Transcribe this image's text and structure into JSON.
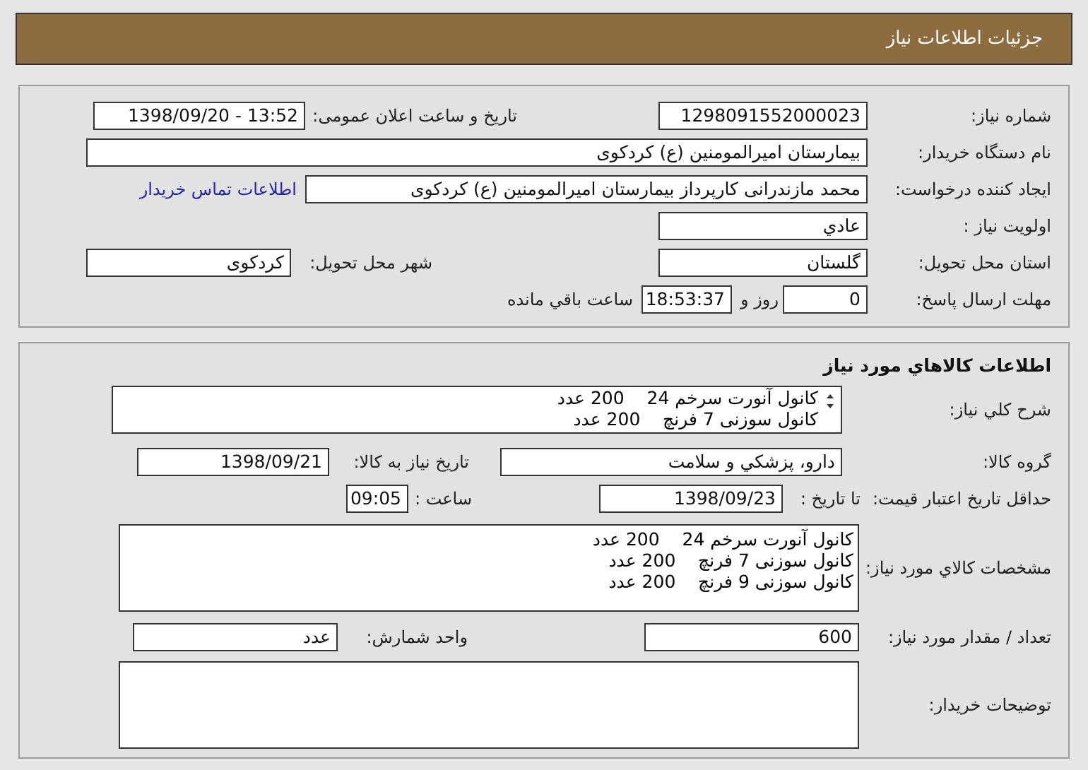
{
  "header": {
    "title": "جزئیات اطلاعات نیاز"
  },
  "general": {
    "need_number": {
      "label": "شماره نیاز:",
      "value": "1298091552000023"
    },
    "announce": {
      "label": "تاریخ و ساعت اعلان عمومی:",
      "value": "1398/09/20 - 13:52"
    },
    "buyer": {
      "label": "نام دستگاه خریدار:",
      "value": "بیمارستان امیرالمومنین (ع) کردکوی"
    },
    "requester": {
      "label": "ایجاد کننده درخواست:",
      "value": "محمد مازندرانی کارپرداز بیمارستان امیرالمومنین (ع) کردکوی"
    },
    "contact_link": "اطلاعات تماس خریدار",
    "priority": {
      "label": "اولویت نیاز :",
      "value": "عادي"
    },
    "province": {
      "label": "استان محل تحویل:",
      "value": "گلستان"
    },
    "city": {
      "label": "شهر محل تحویل:",
      "value": "کردکوی"
    },
    "deadline": {
      "label": "مهلت ارسال پاسخ:",
      "days": "0",
      "days_text": "روز و",
      "time": "18:53:37",
      "remaining_text": "ساعت باقي مانده"
    }
  },
  "goods": {
    "title": "اطلاعات كالاهاي مورد نياز",
    "summary": {
      "label": "شرح كلي نياز:",
      "lines": [
        "كانول آنورت سرخم 24    200 عدد",
        "كانول سوزنی 7 فرنچ    200 عدد"
      ]
    },
    "group": {
      "label": "گروه كالا:",
      "value": "دارو، پزشكي و سلامت"
    },
    "need_date": {
      "label": "تاريخ نياز به كالا:",
      "value": "1398/09/21"
    },
    "validity": {
      "label": "حداقل تاريخ اعتبار قيمت:",
      "to_date_label": "تا تاریخ :",
      "date": "1398/09/23",
      "time_label": "ساعت :",
      "time": "09:05"
    },
    "specs": {
      "label": "مشخصات كالاي مورد نياز:",
      "lines": [
        "كانول آنورت سرخم 24    200 عدد",
        "كانول سوزنی 7 فرنچ    200 عدد",
        "كانول سوزنی 9 فرنچ    200 عدد"
      ]
    },
    "quantity": {
      "label": "تعداد / مقدار مورد نياز:",
      "value": "600"
    },
    "unit": {
      "label": "واحد شمارش:",
      "value": "عدد"
    },
    "notes": {
      "label": "توضيحات خريدار:"
    }
  }
}
